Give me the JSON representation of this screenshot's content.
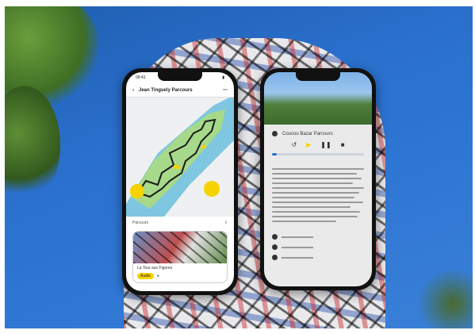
{
  "left_phone": {
    "status_time": "09:41",
    "title": "Jean Tinguely Parcours",
    "route_label": "Parcours",
    "card_title": "La Tour aux Figures",
    "card_tag": "Audio",
    "icons": [
      "back-chevron-icon",
      "menu-icon",
      "location-pin-icon",
      "share-icon"
    ]
  },
  "right_phone": {
    "track_title": "Coucou Bazar Parcours",
    "controls": [
      "skip-back",
      "play",
      "pause",
      "stop"
    ],
    "progress_fraction": 0.05
  },
  "colors": {
    "sky": "#2e76d4",
    "route": "#1a1a1a",
    "accent_yellow": "#f5d200",
    "park_green": "#a6d98a",
    "river_blue": "#7fc6e0"
  }
}
